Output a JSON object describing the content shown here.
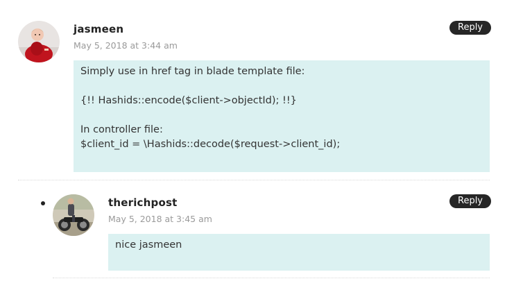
{
  "comments": [
    {
      "author": "jasmeen",
      "date": "May 5, 2018 at 3:44 am",
      "reply_label": "Reply",
      "avatar_icon": "avatar-child-red-dress",
      "body": [
        "Simply use in href tag in blade template file:",
        "{!! Hashids::encode($client->objectId); !!}",
        "In controller file:",
        "$client_id = \\Hashids::decode($request->client_id);"
      ]
    },
    {
      "author": "therichpost",
      "date": "May 5, 2018 at 3:45 am",
      "reply_label": "Reply",
      "avatar_icon": "avatar-motorcycle-rider",
      "body": [
        "nice jasmeen"
      ]
    }
  ],
  "colors": {
    "comment_bg": "#dbf1f1",
    "reply_bg": "#262626"
  }
}
